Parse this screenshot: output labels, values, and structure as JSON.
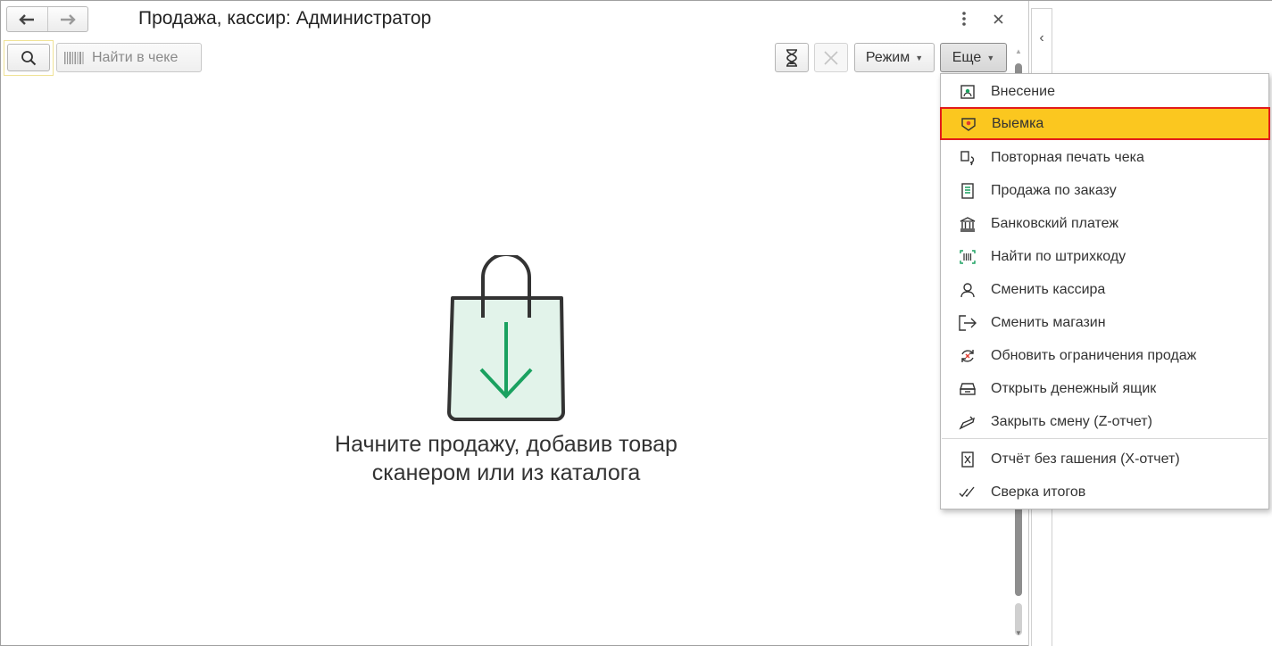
{
  "window": {
    "title": "Продажа, кассир: Администратор",
    "back_icon": "arrow-left-icon",
    "forward_icon": "arrow-right-icon",
    "menu_icon": "more-vertical-icon",
    "close_icon": "close-icon"
  },
  "toolbar": {
    "search_icon": "search-icon",
    "find_in_receipt": "Найти в чеке",
    "barcode_icon": "barcode-icon",
    "hourglass_icon": "hourglass-icon",
    "cancel_icon": "x-icon",
    "mode_label": "Режим",
    "more_label": "Еще"
  },
  "empty_state": {
    "icon": "shopping-bag-download-icon",
    "line1": "Начните продажу, добавив товар",
    "line2": "сканером или из каталога",
    "accent_color": "#1aa160"
  },
  "more_menu": {
    "items": [
      {
        "label": "Внесение",
        "icon": "cash-in-icon"
      },
      {
        "label": "Выемка",
        "icon": "cash-out-icon",
        "highlighted": true
      },
      {
        "label": "Повторная печать чека",
        "icon": "reprint-receipt-icon"
      },
      {
        "label": "Продажа по заказу",
        "icon": "order-document-icon"
      },
      {
        "label": "Банковский платеж",
        "icon": "bank-icon"
      },
      {
        "label": "Найти по штрихкоду",
        "icon": "barcode-scan-icon"
      },
      {
        "label": "Сменить кассира",
        "icon": "user-icon"
      },
      {
        "label": "Сменить магазин",
        "icon": "exit-arrow-icon"
      },
      {
        "label": "Обновить ограничения продаж",
        "icon": "refresh-restrictions-icon"
      },
      {
        "label": "Открыть денежный ящик",
        "icon": "cash-drawer-icon"
      },
      {
        "label": "Закрыть смену (Z-отчет)",
        "icon": "close-shift-icon"
      },
      {
        "label": "Отчёт без гашения (X-отчет)",
        "icon": "x-report-icon"
      },
      {
        "label": "Сверка итогов",
        "icon": "double-check-icon"
      }
    ],
    "highlight_color": "#fbc71f",
    "highlight_border": "#e21b1b"
  }
}
